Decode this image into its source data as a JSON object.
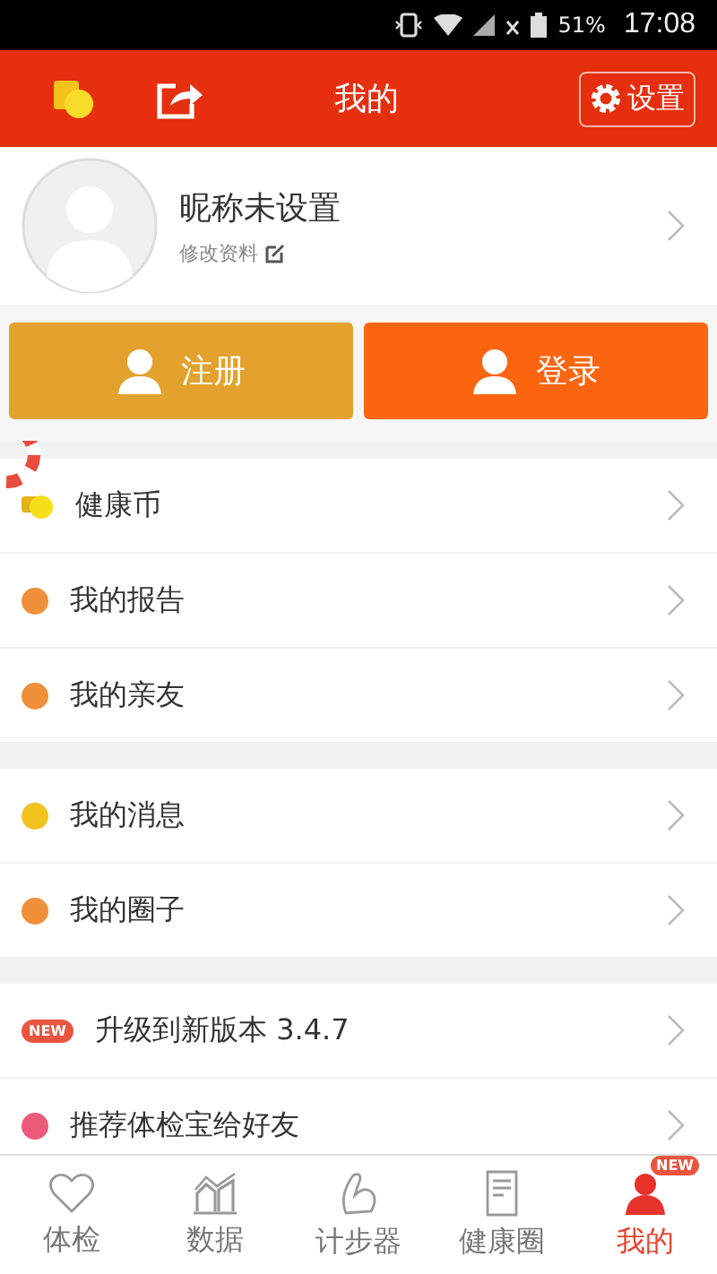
{
  "status_bar": {
    "battery": "51%",
    "time": "17:08"
  },
  "header": {
    "title": "我的",
    "settings_button": "设置"
  },
  "profile": {
    "nickname": "昵称未设置",
    "edit_link": "修改资料"
  },
  "auth_buttons": [
    {
      "label": "注册",
      "kind": "register"
    },
    {
      "label": "登录",
      "kind": "login"
    }
  ],
  "menu_groups": [
    {
      "items": [
        {
          "kind": "coin",
          "label": "健康币"
        },
        {
          "kind": "dot",
          "label": "我的报告",
          "color": "#f0903a"
        },
        {
          "kind": "dot",
          "label": "我的亲友",
          "color": "#f0903a"
        }
      ]
    },
    {
      "items": [
        {
          "kind": "dot",
          "label": "我的消息",
          "color": "#f2c21e"
        },
        {
          "kind": "dot",
          "label": "我的圈子",
          "color": "#f0903a"
        }
      ]
    },
    {
      "items": [
        {
          "kind": "badge",
          "badge": "NEW",
          "label": "升级到新版本 3.4.7"
        },
        {
          "kind": "dot",
          "label": "推荐体检宝给好友",
          "color": "#ec5a7a"
        }
      ]
    }
  ],
  "tabs": [
    {
      "kind": "heart",
      "label": "体检",
      "selected": false
    },
    {
      "kind": "chart",
      "label": "数据",
      "selected": false
    },
    {
      "kind": "steps",
      "label": "计步器",
      "selected": false
    },
    {
      "kind": "doc",
      "label": "健康圈",
      "selected": false
    },
    {
      "kind": "person",
      "label": "我的",
      "selected": true,
      "badge": "NEW"
    }
  ]
}
